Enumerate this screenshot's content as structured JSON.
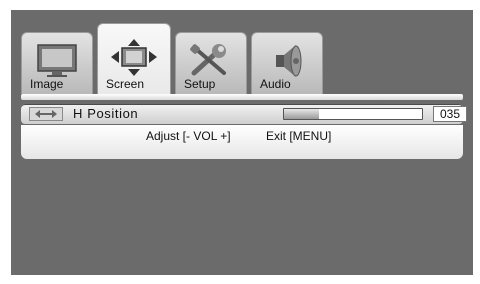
{
  "tabs": [
    {
      "label": "Image",
      "icon": "monitor-icon",
      "active": false
    },
    {
      "label": "Screen",
      "icon": "screen-position-icon",
      "active": true
    },
    {
      "label": "Setup",
      "icon": "wrench-screwdriver-icon",
      "active": false
    },
    {
      "label": "Audio",
      "icon": "speaker-icon",
      "active": false
    }
  ],
  "setting": {
    "label": "H Position",
    "icon": "horizontal-arrows-icon",
    "value": "035",
    "level_percent": 25
  },
  "help": {
    "adjust": "Adjust [- VOL +]",
    "exit": "Exit [MENU]"
  },
  "colors": {
    "background": "#6b6b6b",
    "panel": "#e6e6e6"
  }
}
